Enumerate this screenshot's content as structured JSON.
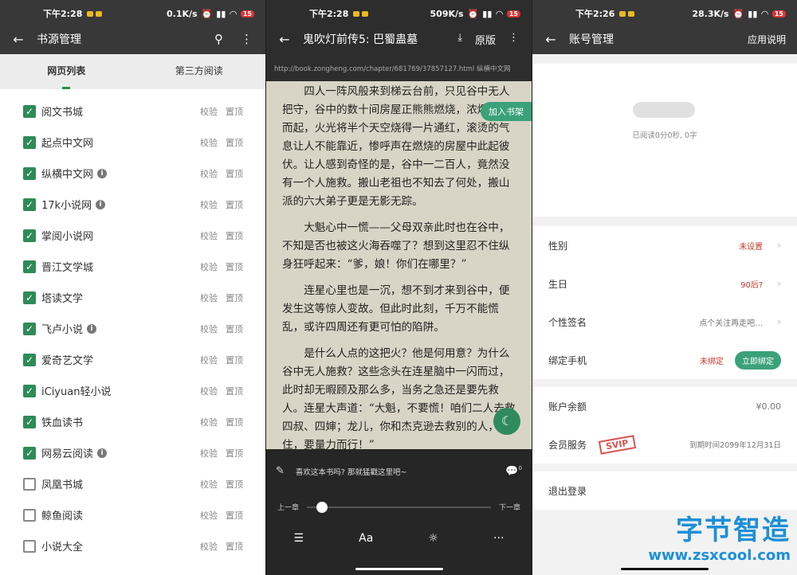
{
  "panel1": {
    "status": {
      "time": "下午2:28",
      "speed": "0.1K/s",
      "battery": "15"
    },
    "title": "书源管理",
    "tabs": [
      "网页列表",
      "第三方阅读"
    ],
    "sources": [
      {
        "name": "阅文书城",
        "checked": true,
        "info": false
      },
      {
        "name": "起点中文网",
        "checked": true,
        "info": false
      },
      {
        "name": "纵横中文网",
        "checked": true,
        "info": true
      },
      {
        "name": "17k小说网",
        "checked": true,
        "info": true
      },
      {
        "name": "掌阅小说网",
        "checked": true,
        "info": false
      },
      {
        "name": "晋江文学城",
        "checked": true,
        "info": false
      },
      {
        "name": "塔读文学",
        "checked": true,
        "info": false
      },
      {
        "name": "飞卢小说",
        "checked": true,
        "info": true
      },
      {
        "name": "爱奇艺文学",
        "checked": true,
        "info": false
      },
      {
        "name": "iCiyuan轻小说",
        "checked": true,
        "info": false
      },
      {
        "name": "铁血读书",
        "checked": true,
        "info": false
      },
      {
        "name": "网易云阅读",
        "checked": true,
        "info": true
      },
      {
        "name": "凤凰书城",
        "checked": false,
        "info": false
      },
      {
        "name": "鲸鱼阅读",
        "checked": false,
        "info": false
      },
      {
        "name": "小说大全",
        "checked": false,
        "info": false
      }
    ],
    "verify_label": "校验",
    "top_label": "置顶"
  },
  "panel2": {
    "status": {
      "time": "下午2:28",
      "speed": "509K/s",
      "battery": "15"
    },
    "title": "鬼吹灯前传5: 巴蜀蛊墓",
    "original_label": "原版",
    "url": "http://book.zongheng.com/chapter/681769/37857127.html   纵横中文网",
    "add_shelf": "加入书架",
    "paragraphs": [
      "四人一阵风般来到梯云台前，只见谷中无人把守，谷中的数十间房屋正熊熊燃烧，浓烟冲天而起，火光将半个天空烧得一片通红，滚烫的气息让人不能靠近，惨呼声在燃烧的房屋中此起彼伏。让人感到奇怪的是，谷中一二百人，竟然没有一个人施救。搬山老祖也不知去了何处，搬山派的六大弟子更是无影无踪。",
      "大魁心中一慌——父母双亲此时也在谷中，不知是否也被这火海吞噬了？想到这里忍不住纵身狂呼起来：“爹，娘！你们在哪里？”",
      "连星心里也是一沉，想不到才来到谷中，便发生这等惊人变故。但此时此刻，千万不能慌乱，或许四周还有更可怕的陷阱。",
      "是什么人点的这把火？他是何用意？为什么谷中无人施救？这些念头在连星脑中一闪而过，此时却无暇顾及那么多，当务之急还是要先救人。连星大声道：“大魁，不要慌！咱们二人去救四叔、四婶；龙儿，你和杰克逊去救别的人，住，要量力而行！”"
    ],
    "comment_placeholder": "喜欢这本书吗? 那就猛戳这里吧~",
    "comment_count": "0",
    "prev_chapter": "上一章",
    "next_chapter": "下一章",
    "progress": 0.05,
    "tools": {
      "aa": "Aa",
      "more": "···"
    }
  },
  "panel3": {
    "status": {
      "time": "下午2:26",
      "speed": "28.3K/s",
      "battery": "15"
    },
    "title": "账号管理",
    "help": "应用说明",
    "read_stat": "已阅读0分0秒, 0字",
    "gender_label": "性别",
    "gender_value": "未设置",
    "birthday_label": "生日",
    "birthday_value": "90后?",
    "sign_label": "个性签名",
    "sign_value": "点个关注再走吧…",
    "phone_label": "绑定手机",
    "phone_value": "未绑定",
    "bind_button": "立即绑定",
    "balance_label": "账户余额",
    "balance_value": "¥0.00",
    "member_label": "会员服务",
    "svip": "SVIP",
    "member_expiry": "到期时间2099年12月31日",
    "logout": "退出登录"
  },
  "watermark": {
    "cn": "字节智造",
    "en": "www.zsxcool.com"
  }
}
